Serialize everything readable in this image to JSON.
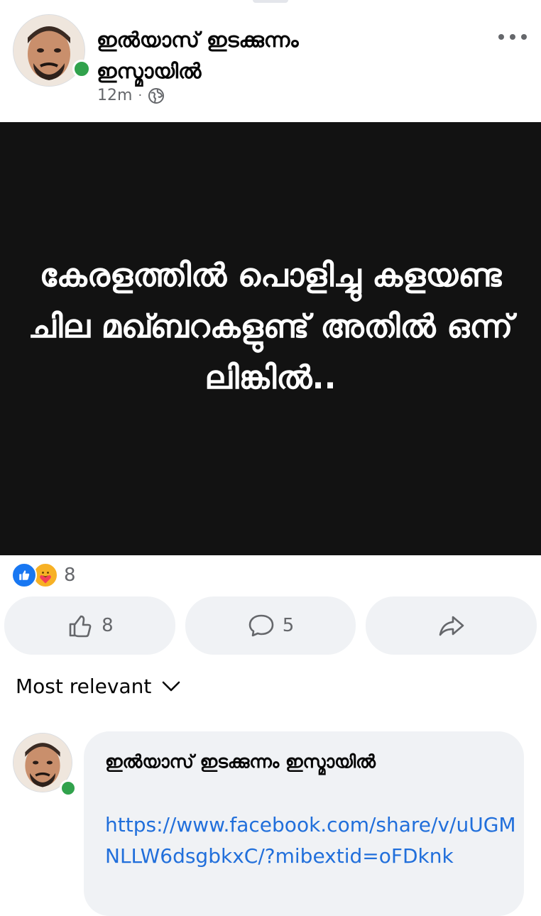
{
  "post": {
    "author": "ഇൽയാസ് ഇടക്കുന്നം ഇസ്മായിൽ",
    "time": "12m",
    "separator": "·",
    "privacy_icon": "globe-icon",
    "more_icon": "more-dots-icon",
    "image_text": "കേരളത്തിൽ പൊളിച്ചു കളയണ്ട ചില മഖ്ബറകളുണ്ട് അതിൽ ഒന്ന് ലിങ്കിൽ.."
  },
  "reactions": {
    "icons": [
      "like-reaction-icon",
      "care-reaction-icon"
    ],
    "count": "8"
  },
  "actions": {
    "like_count": "8",
    "comment_count": "5",
    "share_icon": "share-icon"
  },
  "comments": {
    "sort_label": "Most relevant",
    "items": [
      {
        "author": "ഇൽയാസ് ഇടക്കുന്നം ഇസ്മായിൽ",
        "link": "https://www.facebook.com/share/v/uUGMNLLW6dsgbkxC/?mibextid=oFDknk"
      }
    ]
  },
  "colors": {
    "online": "#31a24c",
    "link": "#216fdb",
    "like_blue": "#1877f2",
    "image_bg": "#121212"
  }
}
